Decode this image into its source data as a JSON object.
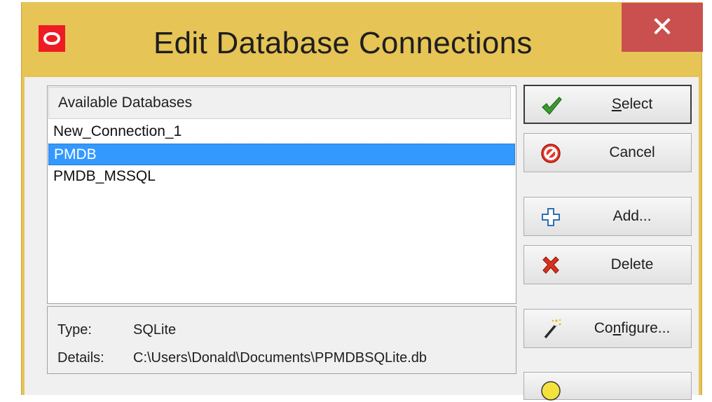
{
  "window": {
    "title": "Edit Database Connections",
    "close_label": "✕"
  },
  "list": {
    "header": "Available Databases",
    "items": [
      {
        "label": "New_Connection_1",
        "selected": false
      },
      {
        "label": "PMDB",
        "selected": true
      },
      {
        "label": "PMDB_MSSQL",
        "selected": false
      }
    ]
  },
  "info": {
    "type_label": "Type:",
    "type_value": "SQLite",
    "details_label": "Details:",
    "details_value": "C:\\Users\\Donald\\Documents\\PPMDBSQLite.db"
  },
  "buttons": {
    "select": {
      "label": "Select",
      "icon": "checkmark-icon"
    },
    "cancel": {
      "label": "Cancel",
      "icon": "no-entry-icon"
    },
    "add": {
      "label": "Add...",
      "icon": "plus-outline-icon"
    },
    "delete": {
      "label": "Delete",
      "icon": "red-x-icon"
    },
    "configure": {
      "label": "Configure...",
      "icon": "magic-wand-icon"
    },
    "partial": {
      "icon": "yellow-circle-icon"
    }
  },
  "colors": {
    "frame": "#e6c455",
    "close": "#c9504f",
    "selection": "#3399ff",
    "app_icon": "#ed1c24"
  }
}
